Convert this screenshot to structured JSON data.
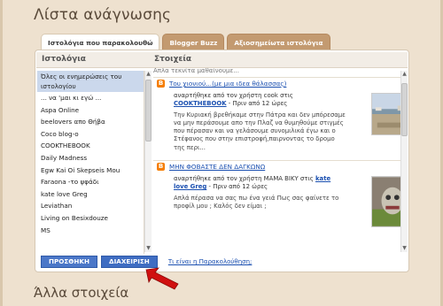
{
  "page": {
    "title": "Λίστα ανάγνωσης",
    "next_section_title": "Άλλα στοιχεία"
  },
  "tabs": [
    {
      "label": "Ιστολόγια που παρακολουθώ",
      "active": true
    },
    {
      "label": "Blogger Buzz",
      "active": false
    },
    {
      "label": "Αξιοσημείωτα ιστολόγια",
      "active": false
    }
  ],
  "panel": {
    "left_header": "Ιστολόγια",
    "right_header": "Στοιχεία"
  },
  "blogs": [
    {
      "label": "Όλες οι ενημερώσεις του ιστολογίου",
      "selected": true
    },
    {
      "label": "... να 'μαι κι εγώ ...",
      "selected": false
    },
    {
      "label": "Aspa Online",
      "selected": false
    },
    {
      "label": "beelovers απο Θήβα",
      "selected": false
    },
    {
      "label": "Coco blog-o",
      "selected": false
    },
    {
      "label": "COOKTHEBOOK",
      "selected": false
    },
    {
      "label": "Daily Madness",
      "selected": false
    },
    {
      "label": "Egw Kai Oi Skepseis Mou",
      "selected": false
    },
    {
      "label": "Faraona -το ψφάδι",
      "selected": false
    },
    {
      "label": "kate love Greg",
      "selected": false
    },
    {
      "label": "Leviathan",
      "selected": false
    },
    {
      "label": "Living on Besixdouze",
      "selected": false
    },
    {
      "label": "MS",
      "selected": false
    }
  ],
  "feed": {
    "top_cut_text": "Απλα τεκνίτα μαθαίνουμε...",
    "items": [
      {
        "title": "Του χιονιού...(με μια ιδεα θάλασσας)",
        "posted_by_prefix": "αναρτήθηκε από τον χρήστη cook στις",
        "blog_name": "COOKTHEBOOK",
        "time": " - Πριν από 12 ώρες",
        "snippet": "Την Κυριακή βρεθήκαμε στην Πάτρα και δεν μπόρεσαμε να μην περάσουμε απο την Πλαζ να θυμηθούμε στιγμές που πέρασαν και να γελάσουμε συνομιλικά έγω και ο Στέφανος που στην επιστροφή,παιρνοντας το δρομο της περι..."
      },
      {
        "title": "ΜΗΝ ΦΟΒΑΣΤΕ ΔΕΝ ΔΑΓΚΩΝΩ",
        "posted_by_prefix": "αναρτήθηκε από τον χρήστη ΜΑΜΑ ΒΙΚΥ στις",
        "blog_name": "kate love Greg",
        "time": " - Πριν από 12 ώρες",
        "snippet": "Απλά πέρασα να σας πω ένα γειά Πως σας φαίνετε το προφίλ μου ; Καλός δεν είμαι ;"
      }
    ]
  },
  "actions": {
    "add_label": "ΠΡΟΣΘΗΚΗ",
    "manage_label": "ΔΙΑΧΕΙΡΙΣΗ",
    "help_link": "Τι είναι η Παρακολούθηση;"
  },
  "icons": {
    "feed_item": "blogger-icon",
    "pointer": "red-arrow-icon"
  },
  "colors": {
    "background": "#eee1cf",
    "tab_inactive": "#c39a70",
    "button": "#4b77c8",
    "link": "#1a4fb0",
    "selected_row": "#cbd8ec",
    "arrow": "#d01010"
  }
}
